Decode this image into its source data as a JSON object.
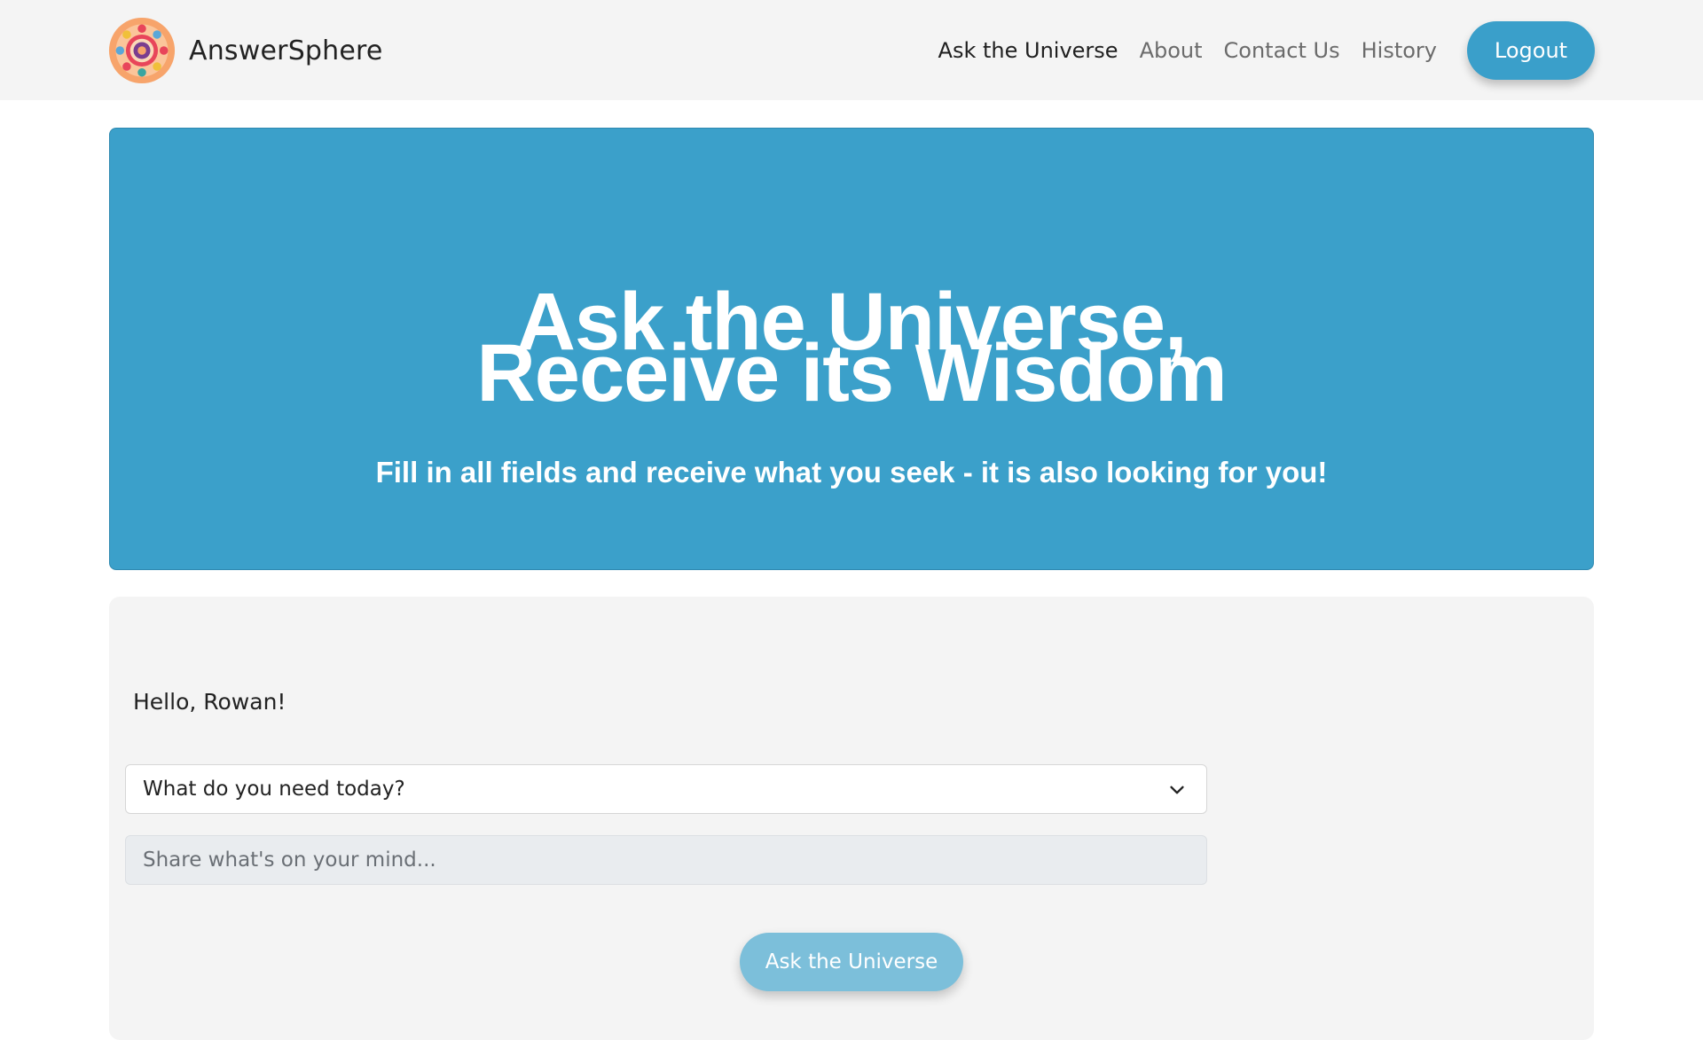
{
  "app": {
    "name": "AnswerSphere",
    "logo_icon": "mandala-logo-icon"
  },
  "nav": {
    "items": [
      {
        "label": "Ask the Universe",
        "active": true
      },
      {
        "label": "About",
        "active": false
      },
      {
        "label": "Contact Us",
        "active": false
      },
      {
        "label": "History",
        "active": false
      }
    ],
    "logout_label": "Logout"
  },
  "hero": {
    "title_line1": "Ask the Universe,",
    "title_line2": "Receive its Wisdom",
    "subtitle": "Fill in all fields and receive what you seek - it is also looking for you!"
  },
  "form": {
    "greeting": "Hello, Rowan!",
    "need_select": {
      "selected": "What do you need today?",
      "icon": "chevron-down-icon"
    },
    "mind_input": {
      "value": "",
      "placeholder": "Share what's on your mind..."
    },
    "submit_label": "Ask the Universe"
  },
  "colors": {
    "primary": "#3ba0ca",
    "primary_disabled": "#7cbfda",
    "navbar_bg": "#f4f4f4",
    "panel_bg": "#f4f4f4",
    "input_bg": "#e9ecef"
  }
}
